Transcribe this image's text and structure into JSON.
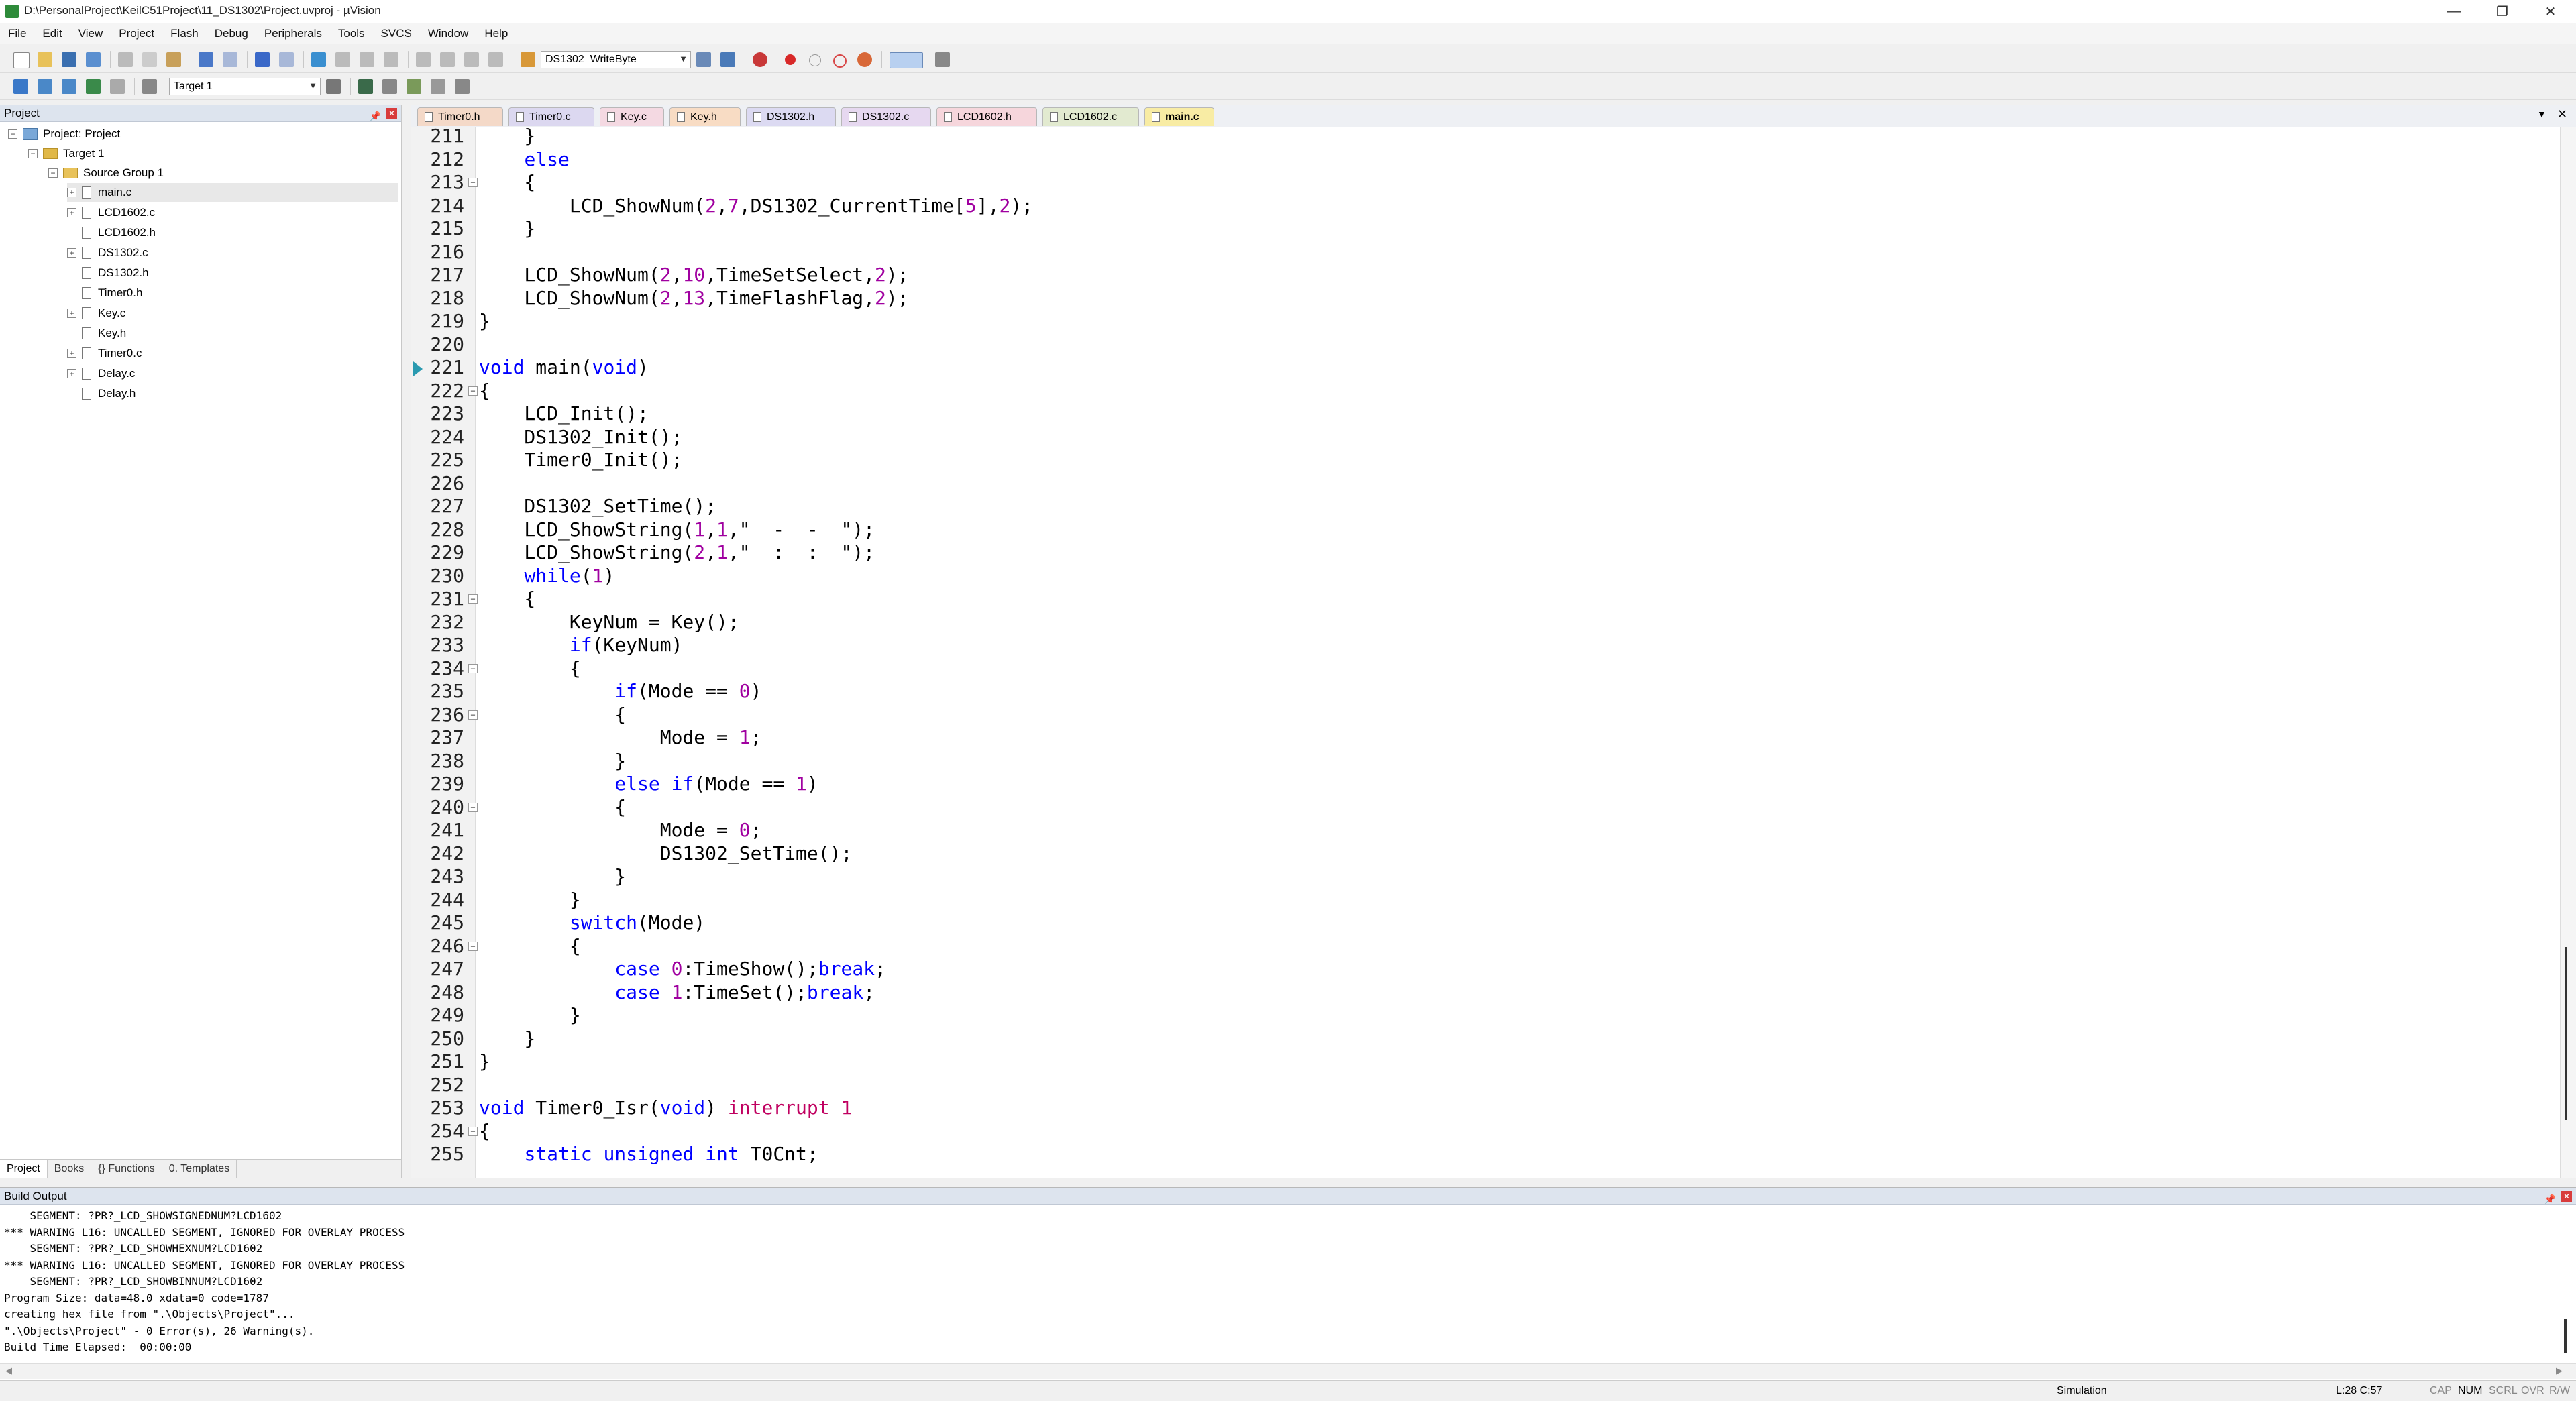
{
  "window": {
    "title": "D:\\PersonalProject\\KeilC51Project\\11_DS1302\\Project.uvproj - µVision",
    "minimize": "—",
    "maximize": "❐",
    "close": "✕"
  },
  "menu": [
    "File",
    "Edit",
    "View",
    "Project",
    "Flash",
    "Debug",
    "Peripherals",
    "Tools",
    "SVCS",
    "Window",
    "Help"
  ],
  "toolbar": {
    "function_combo": "DS1302_WriteByte",
    "target_combo": "Target 1"
  },
  "project_panel": {
    "title": "Project",
    "tree": {
      "root": "Project: Project",
      "target": "Target 1",
      "group": "Source Group 1",
      "files": [
        {
          "name": "main.c",
          "expandable": true
        },
        {
          "name": "LCD1602.c",
          "expandable": true
        },
        {
          "name": "LCD1602.h",
          "expandable": false
        },
        {
          "name": "DS1302.c",
          "expandable": true
        },
        {
          "name": "DS1302.h",
          "expandable": false
        },
        {
          "name": "Timer0.h",
          "expandable": false
        },
        {
          "name": "Key.c",
          "expandable": true
        },
        {
          "name": "Key.h",
          "expandable": false
        },
        {
          "name": "Timer0.c",
          "expandable": true
        },
        {
          "name": "Delay.c",
          "expandable": true
        },
        {
          "name": "Delay.h",
          "expandable": false
        }
      ]
    },
    "tabs": [
      "Project",
      "Books",
      "{} Functions",
      "0. Templates"
    ]
  },
  "editor": {
    "tabs": [
      {
        "label": "Timer0.h",
        "color": "#f4d9c8"
      },
      {
        "label": "Timer0.c",
        "color": "#dcd8f0"
      },
      {
        "label": "Key.c",
        "color": "#f4d9e2"
      },
      {
        "label": "Key.h",
        "color": "#f8dcc4"
      },
      {
        "label": "DS1302.h",
        "color": "#dcdaf2"
      },
      {
        "label": "DS1302.c",
        "color": "#e6d8f0"
      },
      {
        "label": "LCD1602.h",
        "color": "#f6d6dc"
      },
      {
        "label": "LCD1602.c",
        "color": "#e2ead0"
      },
      {
        "label": "main.c",
        "color": "#f8eca4",
        "active": true
      }
    ],
    "lines": [
      {
        "n": "211",
        "fold": "",
        "text": "    }"
      },
      {
        "n": "212",
        "fold": "",
        "text": "    else"
      },
      {
        "n": "213",
        "fold": "−",
        "text": "    {"
      },
      {
        "n": "214",
        "fold": "",
        "text": "        LCD_ShowNum(2,7,DS1302_CurrentTime[5],2);"
      },
      {
        "n": "215",
        "fold": "",
        "text": "    }"
      },
      {
        "n": "216",
        "fold": "",
        "text": ""
      },
      {
        "n": "217",
        "fold": "",
        "text": "    LCD_ShowNum(2,10,TimeSetSelect,2);"
      },
      {
        "n": "218",
        "fold": "",
        "text": "    LCD_ShowNum(2,13,TimeFlashFlag,2);"
      },
      {
        "n": "219",
        "fold": "",
        "text": "}"
      },
      {
        "n": "220",
        "fold": "",
        "text": ""
      },
      {
        "n": "221",
        "fold": "",
        "text": "void main(void)"
      },
      {
        "n": "222",
        "fold": "−",
        "text": "{"
      },
      {
        "n": "223",
        "fold": "",
        "text": "    LCD_Init();"
      },
      {
        "n": "224",
        "fold": "",
        "text": "    DS1302_Init();"
      },
      {
        "n": "225",
        "fold": "",
        "text": "    Timer0_Init();"
      },
      {
        "n": "226",
        "fold": "",
        "text": ""
      },
      {
        "n": "227",
        "fold": "",
        "text": "    DS1302_SetTime();"
      },
      {
        "n": "228",
        "fold": "",
        "text": "    LCD_ShowString(1,1,\"  -  -  \");"
      },
      {
        "n": "229",
        "fold": "",
        "text": "    LCD_ShowString(2,1,\"  :  :  \");"
      },
      {
        "n": "230",
        "fold": "",
        "text": "    while(1)"
      },
      {
        "n": "231",
        "fold": "−",
        "text": "    {"
      },
      {
        "n": "232",
        "fold": "",
        "text": "        KeyNum = Key();"
      },
      {
        "n": "233",
        "fold": "",
        "text": "        if(KeyNum)"
      },
      {
        "n": "234",
        "fold": "−",
        "text": "        {"
      },
      {
        "n": "235",
        "fold": "",
        "text": "            if(Mode == 0)"
      },
      {
        "n": "236",
        "fold": "−",
        "text": "            {"
      },
      {
        "n": "237",
        "fold": "",
        "text": "                Mode = 1;"
      },
      {
        "n": "238",
        "fold": "",
        "text": "            }"
      },
      {
        "n": "239",
        "fold": "",
        "text": "            else if(Mode == 1)"
      },
      {
        "n": "240",
        "fold": "−",
        "text": "            {"
      },
      {
        "n": "241",
        "fold": "",
        "text": "                Mode = 0;"
      },
      {
        "n": "242",
        "fold": "",
        "text": "                DS1302_SetTime();"
      },
      {
        "n": "243",
        "fold": "",
        "text": "            }"
      },
      {
        "n": "244",
        "fold": "",
        "text": "        }"
      },
      {
        "n": "245",
        "fold": "",
        "text": "        switch(Mode)"
      },
      {
        "n": "246",
        "fold": "−",
        "text": "        {"
      },
      {
        "n": "247",
        "fold": "",
        "text": "            case 0:TimeShow();break;"
      },
      {
        "n": "248",
        "fold": "",
        "text": "            case 1:TimeSet();break;"
      },
      {
        "n": "249",
        "fold": "",
        "text": "        }"
      },
      {
        "n": "250",
        "fold": "",
        "text": "    }"
      },
      {
        "n": "251",
        "fold": "",
        "text": "}"
      },
      {
        "n": "252",
        "fold": "",
        "text": ""
      },
      {
        "n": "253",
        "fold": "",
        "text": "void Timer0_Isr(void) interrupt 1"
      },
      {
        "n": "254",
        "fold": "−",
        "text": "{"
      },
      {
        "n": "255",
        "fold": "",
        "text": "    static unsigned int T0Cnt;"
      }
    ]
  },
  "build_output": {
    "title": "Build Output",
    "lines": [
      "    SEGMENT: ?PR?_LCD_SHOWSIGNEDNUM?LCD1602",
      "*** WARNING L16: UNCALLED SEGMENT, IGNORED FOR OVERLAY PROCESS",
      "    SEGMENT: ?PR?_LCD_SHOWHEXNUM?LCD1602",
      "*** WARNING L16: UNCALLED SEGMENT, IGNORED FOR OVERLAY PROCESS",
      "    SEGMENT: ?PR?_LCD_SHOWBINNUM?LCD1602",
      "Program Size: data=48.0 xdata=0 code=1787",
      "creating hex file from \".\\Objects\\Project\"...",
      "\".\\Objects\\Project\" - 0 Error(s), 26 Warning(s).",
      "Build Time Elapsed:  00:00:00"
    ]
  },
  "status": {
    "mode": "Simulation",
    "position": "L:28 C:57",
    "cap": "CAP",
    "num": "NUM",
    "scrl": "SCRL",
    "ovr": "OVR",
    "rw": "R/W"
  }
}
